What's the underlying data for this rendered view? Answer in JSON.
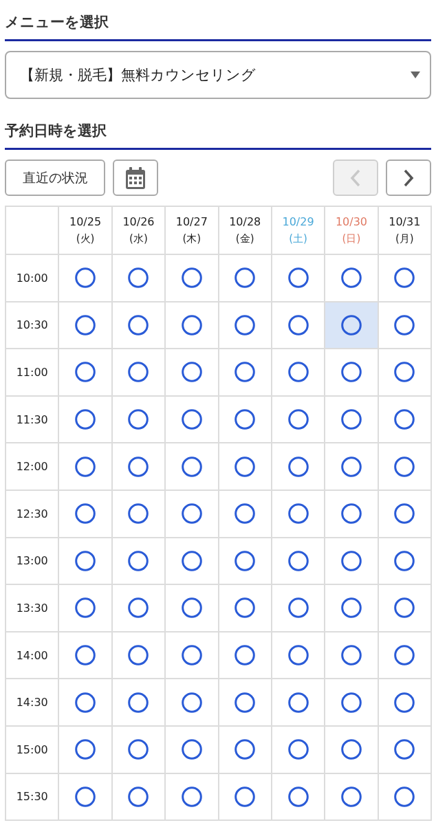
{
  "menu_section": {
    "heading": "メニューを選択",
    "select": {
      "value": "【新規・脱毛】無料カウンセリング"
    }
  },
  "datetime_section": {
    "heading": "予約日時を選択",
    "toolbar": {
      "recent_button": "直近の状況",
      "prev_button": {
        "disabled": true
      },
      "next_button": {
        "disabled": false
      }
    },
    "table": {
      "columns": [
        {
          "date": "10/25",
          "weekday": "(火)",
          "color": "#222222"
        },
        {
          "date": "10/26",
          "weekday": "(水)",
          "color": "#222222"
        },
        {
          "date": "10/27",
          "weekday": "(木)",
          "color": "#222222"
        },
        {
          "date": "10/28",
          "weekday": "(金)",
          "color": "#222222"
        },
        {
          "date": "10/29",
          "weekday": "(土)",
          "color": "#4aa8d8"
        },
        {
          "date": "10/30",
          "weekday": "(日)",
          "color": "#e07a64"
        },
        {
          "date": "10/31",
          "weekday": "(月)",
          "color": "#222222"
        }
      ],
      "rows": [
        {
          "time": "10:00",
          "slots": [
            {
              "available": true,
              "selected": false
            },
            {
              "available": true,
              "selected": false
            },
            {
              "available": true,
              "selected": false
            },
            {
              "available": true,
              "selected": false
            },
            {
              "available": true,
              "selected": false
            },
            {
              "available": true,
              "selected": false
            },
            {
              "available": true,
              "selected": false
            }
          ]
        },
        {
          "time": "10:30",
          "slots": [
            {
              "available": true,
              "selected": false
            },
            {
              "available": true,
              "selected": false
            },
            {
              "available": true,
              "selected": false
            },
            {
              "available": true,
              "selected": false
            },
            {
              "available": true,
              "selected": false
            },
            {
              "available": true,
              "selected": true
            },
            {
              "available": true,
              "selected": false
            }
          ]
        },
        {
          "time": "11:00",
          "slots": [
            {
              "available": true,
              "selected": false
            },
            {
              "available": true,
              "selected": false
            },
            {
              "available": true,
              "selected": false
            },
            {
              "available": true,
              "selected": false
            },
            {
              "available": true,
              "selected": false
            },
            {
              "available": true,
              "selected": false
            },
            {
              "available": true,
              "selected": false
            }
          ]
        },
        {
          "time": "11:30",
          "slots": [
            {
              "available": true,
              "selected": false
            },
            {
              "available": true,
              "selected": false
            },
            {
              "available": true,
              "selected": false
            },
            {
              "available": true,
              "selected": false
            },
            {
              "available": true,
              "selected": false
            },
            {
              "available": true,
              "selected": false
            },
            {
              "available": true,
              "selected": false
            }
          ]
        },
        {
          "time": "12:00",
          "slots": [
            {
              "available": true,
              "selected": false
            },
            {
              "available": true,
              "selected": false
            },
            {
              "available": true,
              "selected": false
            },
            {
              "available": true,
              "selected": false
            },
            {
              "available": true,
              "selected": false
            },
            {
              "available": true,
              "selected": false
            },
            {
              "available": true,
              "selected": false
            }
          ]
        },
        {
          "time": "12:30",
          "slots": [
            {
              "available": true,
              "selected": false
            },
            {
              "available": true,
              "selected": false
            },
            {
              "available": true,
              "selected": false
            },
            {
              "available": true,
              "selected": false
            },
            {
              "available": true,
              "selected": false
            },
            {
              "available": true,
              "selected": false
            },
            {
              "available": true,
              "selected": false
            }
          ]
        },
        {
          "time": "13:00",
          "slots": [
            {
              "available": true,
              "selected": false
            },
            {
              "available": true,
              "selected": false
            },
            {
              "available": true,
              "selected": false
            },
            {
              "available": true,
              "selected": false
            },
            {
              "available": true,
              "selected": false
            },
            {
              "available": true,
              "selected": false
            },
            {
              "available": true,
              "selected": false
            }
          ]
        },
        {
          "time": "13:30",
          "slots": [
            {
              "available": true,
              "selected": false
            },
            {
              "available": true,
              "selected": false
            },
            {
              "available": true,
              "selected": false
            },
            {
              "available": true,
              "selected": false
            },
            {
              "available": true,
              "selected": false
            },
            {
              "available": true,
              "selected": false
            },
            {
              "available": true,
              "selected": false
            }
          ]
        },
        {
          "time": "14:00",
          "slots": [
            {
              "available": true,
              "selected": false
            },
            {
              "available": true,
              "selected": false
            },
            {
              "available": true,
              "selected": false
            },
            {
              "available": true,
              "selected": false
            },
            {
              "available": true,
              "selected": false
            },
            {
              "available": true,
              "selected": false
            },
            {
              "available": true,
              "selected": false
            }
          ]
        },
        {
          "time": "14:30",
          "slots": [
            {
              "available": true,
              "selected": false
            },
            {
              "available": true,
              "selected": false
            },
            {
              "available": true,
              "selected": false
            },
            {
              "available": true,
              "selected": false
            },
            {
              "available": true,
              "selected": false
            },
            {
              "available": true,
              "selected": false
            },
            {
              "available": true,
              "selected": false
            }
          ]
        },
        {
          "time": "15:00",
          "slots": [
            {
              "available": true,
              "selected": false
            },
            {
              "available": true,
              "selected": false
            },
            {
              "available": true,
              "selected": false
            },
            {
              "available": true,
              "selected": false
            },
            {
              "available": true,
              "selected": false
            },
            {
              "available": true,
              "selected": false
            },
            {
              "available": true,
              "selected": false
            }
          ]
        },
        {
          "time": "15:30",
          "slots": [
            {
              "available": true,
              "selected": false
            },
            {
              "available": true,
              "selected": false
            },
            {
              "available": true,
              "selected": false
            },
            {
              "available": true,
              "selected": false
            },
            {
              "available": true,
              "selected": false
            },
            {
              "available": true,
              "selected": false
            },
            {
              "available": true,
              "selected": false
            }
          ]
        }
      ]
    }
  }
}
